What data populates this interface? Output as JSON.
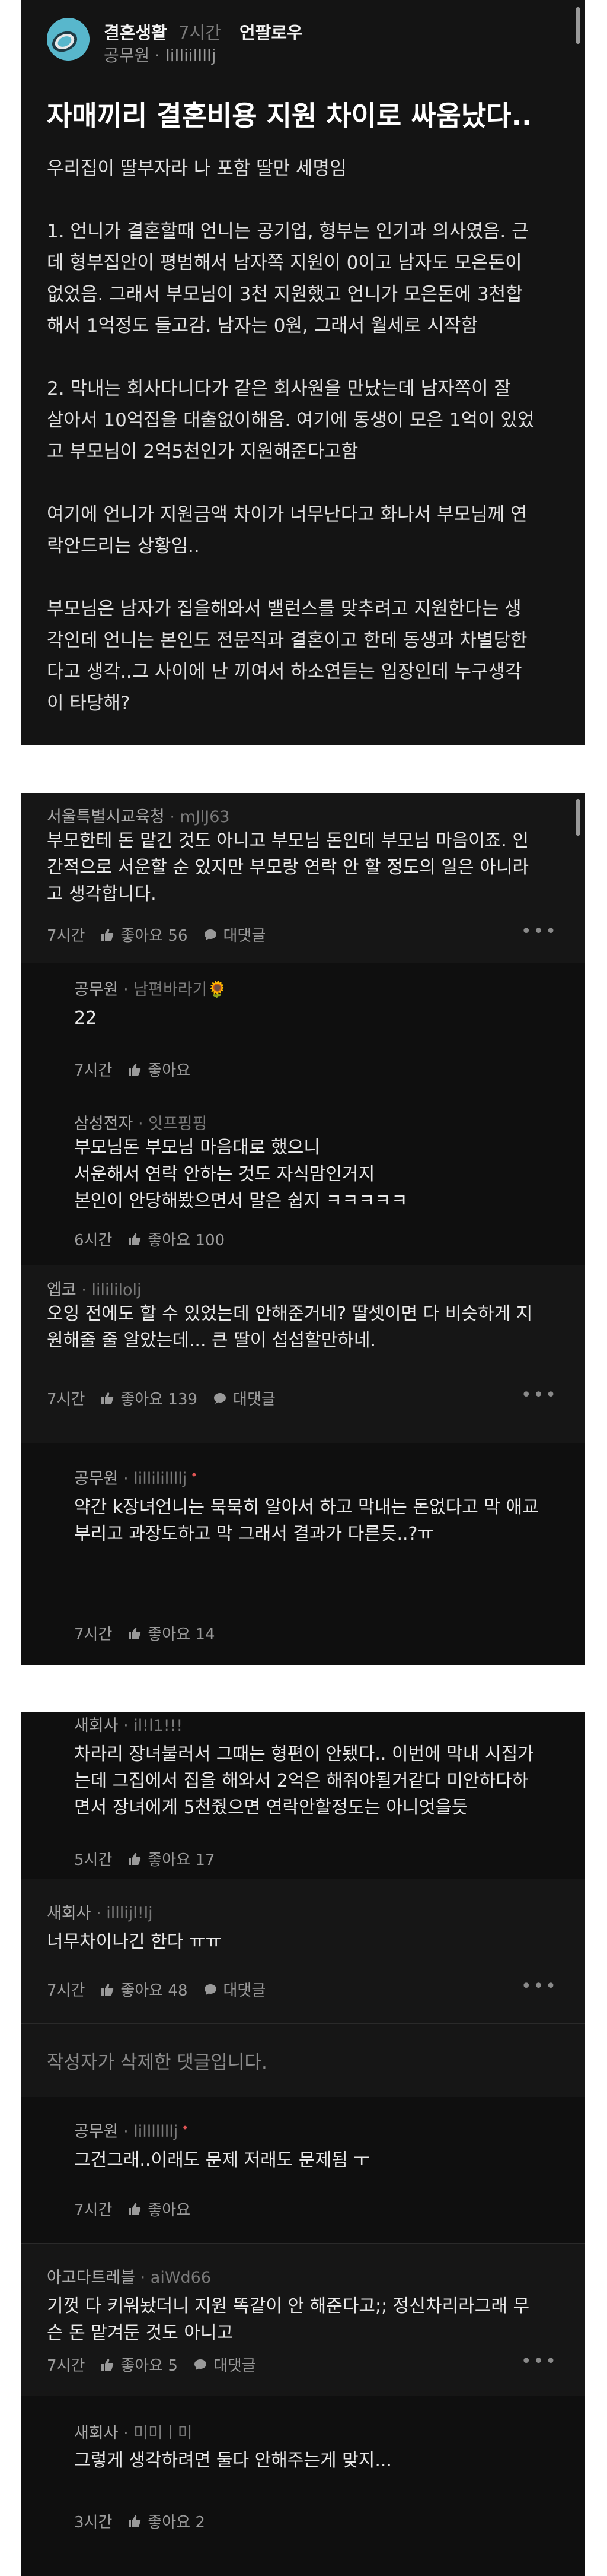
{
  "post": {
    "board": "결혼생활",
    "time": "7시간",
    "follow": "언팔로우",
    "author": "공무원 · lilliillllj",
    "title": "자매끼리 결혼비용 지원 차이로 싸움났다..",
    "paragraphs": [
      [
        "우리집이 딸부자라 나 포함 딸만 세명임"
      ],
      [
        "1. 언니가 결혼할때 언니는 공기업, 형부는  인기과 의사였음. 근",
        "데 형부집안이 평범해서 남자쪽 지원이 0이고 남자도 모은돈이",
        "없었음. 그래서 부모님이 3천 지원했고 언니가 모은돈에 3천합",
        "해서 1억정도 들고감. 남자는 0원, 그래서 월세로 시작함"
      ],
      [
        "2. 막내는 회사다니다가 같은 회사원을 만났는데 남자쪽이 잘",
        "살아서 10억집을 대출없이해옴. 여기에 동생이 모은 1억이 있었",
        "고 부모님이 2억5천인가 지원해준다고함"
      ],
      [
        "여기에 언니가 지원금액 차이가 너무난다고 화나서 부모님께 연",
        "락안드리는 상황임.."
      ],
      [
        "부모님은 남자가 집을해와서 밸런스를 맞추려고 지원한다는 생",
        "각인데 언니는 본인도 전문직과 결혼이고 한데 동생과 차별당한",
        "다고 생각..그 사이에 난 끼여서 하소연듣는 입장인데 누구생각",
        "이 타당해?"
      ]
    ]
  },
  "comments": [
    {
      "author": "서울특별시교육청",
      "nick": "mJlJ63",
      "lines": [
        "부모한테 돈 맡긴 것도 아니고 부모님 돈인데 부모님 마음이죠. 인",
        "간적으로 서운할 순 있지만 부모랑 연락 안 할 정도의 일은 아니라",
        "고 생각합니다."
      ],
      "time": "7시간",
      "likes": "좋아요 56",
      "reply_label": "대댓글"
    },
    {
      "author": "공무원",
      "nick": "남편바라기🌻",
      "lines": [
        "22"
      ],
      "time": "7시간",
      "likes": "좋아요"
    },
    {
      "author": "삼성전자",
      "nick": "잇프핑핑",
      "lines": [
        "부모님돈 부모님 마음대로 했으니",
        "서운해서 연락 안하는 것도 자식맘인거지",
        "본인이 안당해봤으면서 말은 쉽지 ㅋㅋㅋㅋㅋ"
      ],
      "time": "6시간",
      "likes": "좋아요 100"
    },
    {
      "author": "엡코",
      "nick": "lilililolj",
      "lines": [
        "오잉 전에도 할 수 있었는데 안해준거네? 딸셋이면 다 비슷하게 지",
        "원해줄 줄 알았는데... 큰 딸이 섭섭할만하네."
      ],
      "time": "7시간",
      "likes": "좋아요 139",
      "reply_label": "대댓글"
    },
    {
      "author": "공무원",
      "nick": "lillilillllj",
      "marker": "•",
      "lines": [
        "약간 k장녀언니는 묵묵히 알아서 하고 막내는 돈없다고 막 애교",
        "부리고 과장도하고 막 그래서 결과가 다른듯..?ㅠ"
      ],
      "time": "7시간",
      "likes": "좋아요 14"
    },
    {
      "author": "새회사",
      "nick": "il!l1!!!",
      "lines": [
        "차라리 장녀불러서 그때는 형편이 안됐다.. 이번에 막내 시집가",
        "는데 그집에서 집을 해와서 2억은 해줘야될거같다 미안하다하",
        "면서 장녀에게 5천줬으면 연락안할정도는 아니엇을듯"
      ],
      "time": "5시간",
      "likes": "좋아요 17"
    },
    {
      "author": "새회사",
      "nick": "illlijl!lj",
      "lines": [
        "너무차이나긴 한다 ㅠㅠ"
      ],
      "time": "7시간",
      "likes": "좋아요 48",
      "reply_label": "대댓글"
    },
    {
      "deleted": "작성자가 삭제한 댓글입니다."
    },
    {
      "author": "공무원",
      "nick": "lilllllllj",
      "marker": "•",
      "lines": [
        "그건그래..이래도 문제 저래도 문제됨 ㅜ"
      ],
      "time": "7시간",
      "likes": "좋아요"
    },
    {
      "author": "아고다트레블",
      "nick": "aiWd66",
      "lines": [
        "기껏 다 키워놨더니 지원 똑같이 안 해준다고;; 정신차리라그래 무",
        "슨 돈 맡겨둔 것도 아니고"
      ],
      "time": "7시간",
      "likes": "좋아요 5",
      "reply_label": "대댓글"
    },
    {
      "author": "새회사",
      "nick": "미미ㅣ미",
      "lines": [
        "그렇게 생각하려면 둘다 안해주는게 맞지..."
      ],
      "time": "3시간",
      "likes": "좋아요 2"
    }
  ],
  "icons": {
    "avatar": "lemon-slice-avatar",
    "like": "thumbs-up-icon",
    "reply": "comment-bubble-icon",
    "more": "more-dots-icon"
  },
  "more_glyph": "•••",
  "dot": " · "
}
